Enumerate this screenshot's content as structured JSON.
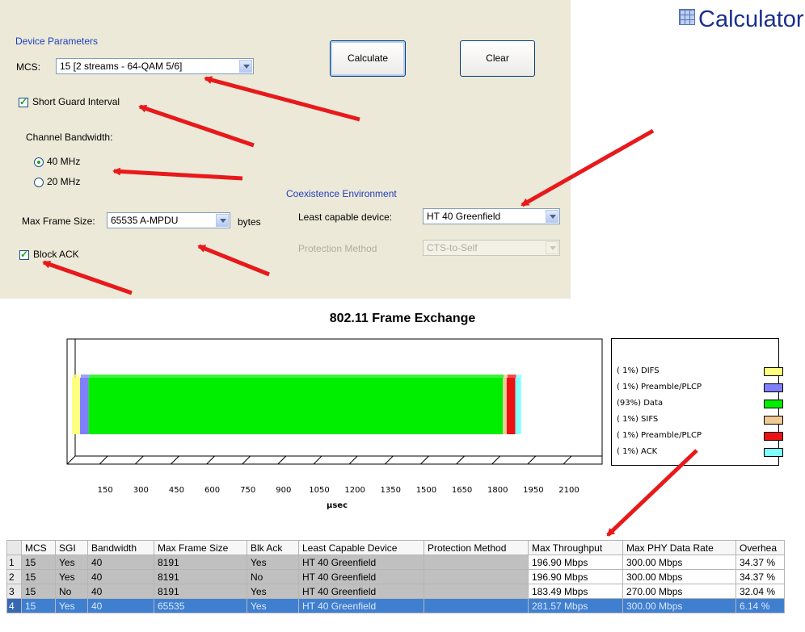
{
  "app": {
    "title": "Calculator"
  },
  "device_parameters": {
    "section_label": "Device Parameters",
    "mcs_label": "MCS:",
    "mcs_value": "15 [2 streams - 64-QAM 5/6]",
    "short_guard_interval": {
      "label": "Short Guard Interval",
      "checked": true
    },
    "channel_bandwidth_label": "Channel Bandwidth:",
    "bandwidth_options": [
      {
        "label": "40 MHz",
        "selected": true
      },
      {
        "label": "20 MHz",
        "selected": false
      }
    ],
    "max_frame_size_label": "Max Frame Size:",
    "max_frame_size_value": "65535 A-MPDU",
    "max_frame_size_unit": "bytes",
    "block_ack": {
      "label": "Block ACK",
      "checked": true
    }
  },
  "buttons": {
    "calculate": "Calculate",
    "clear": "Clear"
  },
  "coexistence": {
    "section_label": "Coexistence Environment",
    "least_capable_label": "Least capable device:",
    "least_capable_value": "HT 40 Greenfield",
    "protection_label": "Protection Method",
    "protection_value": "CTS-to-Self"
  },
  "chart_data": {
    "type": "bar",
    "title": "802.11 Frame Exchange",
    "xlabel": "µsec",
    "x_ticks": [
      "150",
      "300",
      "450",
      "600",
      "750",
      "900",
      "1050",
      "1200",
      "1350",
      "1500",
      "1650",
      "1800",
      "1950",
      "2100"
    ],
    "xlim": [
      0,
      2250
    ],
    "orientation": "horizontal-stacked",
    "legend_position": "right",
    "segments": [
      {
        "name": "( 1%) DIFS",
        "start": 0,
        "duration": 34,
        "color": "#ffff80"
      },
      {
        "name": "( 1%) Preamble/PLCP",
        "start": 34,
        "duration": 36,
        "color": "#8080ff"
      },
      {
        "name": "(93%) Data",
        "start": 70,
        "duration": 1742,
        "color": "#00ee00"
      },
      {
        "name": "( 1%) SIFS",
        "start": 1812,
        "duration": 16,
        "color": "#f0c896"
      },
      {
        "name": "( 1%) Preamble/PLCP",
        "start": 1828,
        "duration": 36,
        "color": "#ee1111"
      },
      {
        "name": "( 1%) ACK",
        "start": 1864,
        "duration": 24,
        "color": "#80ffff"
      }
    ]
  },
  "results_table": {
    "columns": [
      "",
      "MCS",
      "SGI",
      "Bandwidth",
      "Max Frame Size",
      "Blk Ack",
      "Least Capable Device",
      "Protection Method",
      "Max Throughput",
      "Max PHY Data Rate",
      "Overhea"
    ],
    "rows": [
      [
        "1",
        "15",
        "Yes",
        "40",
        "8191",
        "Yes",
        "HT 40 Greenfield",
        "",
        "196.90 Mbps",
        "300.00 Mbps",
        "34.37 %"
      ],
      [
        "2",
        "15",
        "Yes",
        "40",
        "8191",
        "No",
        "HT 40 Greenfield",
        "",
        "196.90 Mbps",
        "300.00 Mbps",
        "34.37 %"
      ],
      [
        "3",
        "15",
        "No",
        "40",
        "8191",
        "Yes",
        "HT 40 Greenfield",
        "",
        "183.49 Mbps",
        "270.00 Mbps",
        "32.04 %"
      ],
      [
        "4",
        "15",
        "Yes",
        "40",
        "65535",
        "Yes",
        "HT 40 Greenfield",
        "",
        "281.57 Mbps",
        "300.00 Mbps",
        "6.14 %"
      ]
    ],
    "selected_row": 3
  },
  "colors": {
    "annotation_arrow": "#e8191b",
    "section_label": "#1f3fbf",
    "selected_row": "#3f7fd0"
  }
}
